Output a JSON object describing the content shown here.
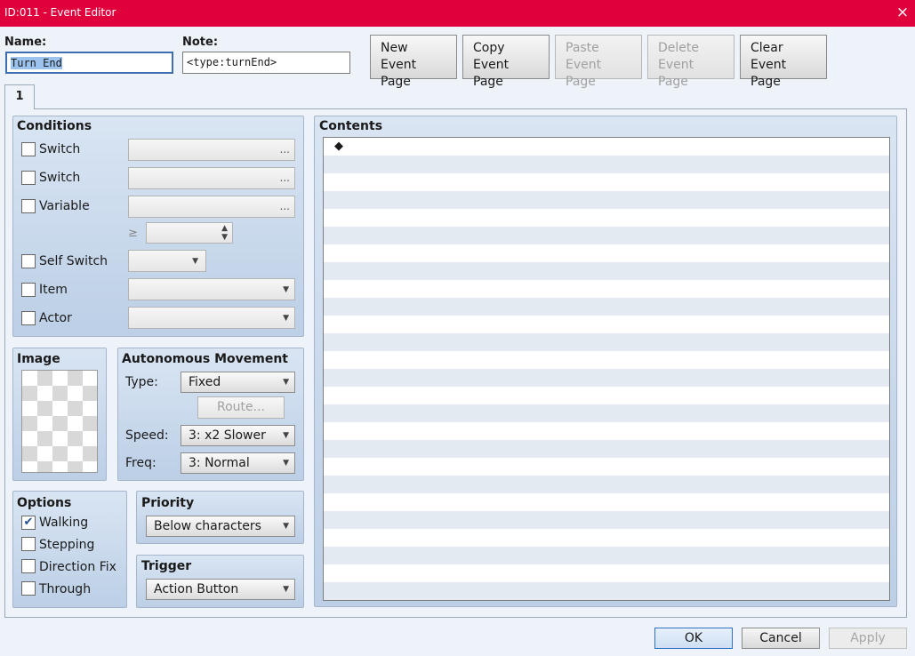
{
  "window": {
    "title": "ID:011 - Event Editor",
    "close_icon": "×"
  },
  "header": {
    "name_label": "Name:",
    "name_value": "Turn End",
    "note_label": "Note:",
    "note_value": "<type:turnEnd>",
    "buttons": {
      "new": "New\nEvent Page",
      "copy": "Copy\nEvent Page",
      "paste": "Paste\nEvent Page",
      "delete": "Delete\nEvent Page",
      "clear": "Clear\nEvent Page"
    }
  },
  "tabs": [
    {
      "label": "1",
      "active": true
    }
  ],
  "conditions": {
    "title": "Conditions",
    "switch1": "Switch",
    "switch2": "Switch",
    "variable": "Variable",
    "gte": "≥",
    "self_switch": "Self Switch",
    "item": "Item",
    "actor": "Actor",
    "dots": "..."
  },
  "image": {
    "title": "Image"
  },
  "movement": {
    "title": "Autonomous Movement",
    "type_label": "Type:",
    "type_value": "Fixed",
    "route_button": "Route...",
    "speed_label": "Speed:",
    "speed_value": "3: x2 Slower",
    "freq_label": "Freq:",
    "freq_value": "3: Normal"
  },
  "options": {
    "title": "Options",
    "walking": {
      "label": "Walking",
      "checked": true
    },
    "stepping": {
      "label": "Stepping",
      "checked": false
    },
    "direction_fix": {
      "label": "Direction Fix",
      "checked": false
    },
    "through": {
      "label": "Through",
      "checked": false
    }
  },
  "priority": {
    "title": "Priority",
    "value": "Below characters"
  },
  "trigger": {
    "title": "Trigger",
    "value": "Action Button"
  },
  "contents": {
    "title": "Contents",
    "first_line": "◆"
  },
  "footer": {
    "ok": "OK",
    "cancel": "Cancel",
    "apply": "Apply"
  }
}
